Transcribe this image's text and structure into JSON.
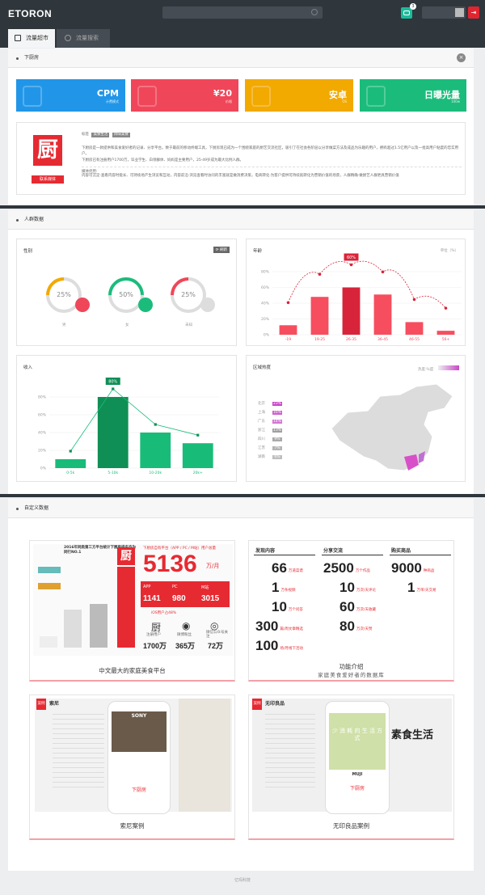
{
  "app": {
    "logo": "ETORON",
    "notif_count": "3",
    "logout_icon": "logout-icon"
  },
  "tabs": [
    {
      "label": "流量超市"
    },
    {
      "label": "流量搜索"
    }
  ],
  "media_panel": {
    "title": "下厨房",
    "kpis": [
      {
        "value": "CPM",
        "label": "计费模式",
        "color": "#2196e8"
      },
      {
        "value": "¥20",
        "label": "价格",
        "color": "#f0465a"
      },
      {
        "value": "安卓",
        "label": "OS",
        "color": "#f2a900"
      },
      {
        "value": "日曝光量",
        "label": "100w",
        "color": "#1bbc7b"
      }
    ],
    "logo_char": "厨",
    "contact_label": "联系媒体",
    "tags_label": "标签",
    "tags": [
      "美食生活",
      "风味美食"
    ],
    "desc": "下厨房是一款提供和美食爱好者的记录、分享平台。致于最前的移动终端工具，下厨房现已成为一个围绕家庭的厨艺交流社区，吸引了在社会各阶层以分享做菜方法及成品为乐趣的用户，拥有超过1.5亿用户以及一批高用户粘度的忠实用户。",
    "desc2": "下厨房已有注册用户1700万，毕业学生、白领群体、妈妈是主要用户，25-49岁成为最大比例人群。",
    "note_label": "媒体优势:",
    "note": "内容可沉淀·查看内容时能长、可持续地产生浏览和互动，内容前沿·浏览查看时访问的丰富就是做消费决策，电商转化·为客户提供可持续就转化为营销价值的场景，人群精确·做厨艺人群更具营销价值"
  },
  "audience": {
    "title": "人群数据",
    "gender": {
      "title": "性别",
      "btn": "刷新",
      "items": [
        {
          "value": "25%",
          "label": "男",
          "color": "#f2a900"
        },
        {
          "value": "50%",
          "label": "女",
          "color": "#1bbc7b"
        },
        {
          "value": "25%",
          "label": "未知",
          "color": "#f0465a"
        }
      ]
    },
    "age": {
      "title": "年龄",
      "unit": "单位（%）",
      "highlight": "60%"
    },
    "income": {
      "title": "收入",
      "highlight": "80%"
    },
    "region": {
      "title": "区域热度",
      "legend_label": "热度·%度",
      "items": [
        {
          "name": "北京",
          "value": "23%"
        },
        {
          "name": "上海",
          "value": "16%"
        },
        {
          "name": "广东",
          "value": "14%"
        },
        {
          "name": "浙江",
          "value": "13%"
        },
        {
          "name": "四川",
          "value": "9%"
        },
        {
          "name": "江苏",
          "value": "7%"
        },
        {
          "name": "湖南",
          "value": "6%"
        }
      ]
    }
  },
  "chart_data": [
    {
      "type": "bar",
      "title": "年龄",
      "categories": [
        "-19",
        "19-25",
        "26-35",
        "36-45",
        "46-55",
        "56+"
      ],
      "values": [
        12,
        48,
        60,
        51,
        16,
        5
      ],
      "ylim": [
        0,
        80
      ],
      "yticks": [
        "0%",
        "20%",
        "40%",
        "60%",
        "80%"
      ]
    },
    {
      "type": "bar",
      "title": "收入",
      "categories": [
        "0-5k",
        "5-10k",
        "10-20k",
        "20k+"
      ],
      "values": [
        10,
        80,
        40,
        28
      ],
      "ylim": [
        0,
        80
      ],
      "yticks": [
        "0%",
        "20%",
        "40%",
        "60%",
        "80%"
      ]
    }
  ],
  "custom": {
    "title": "自定义数据",
    "case1": {
      "caption": "中文最大的家庭美食平台",
      "big": "5136",
      "unit": "万/月",
      "header": "下厨房自有平台（APP / PC / M站）用户总量",
      "app": "APP",
      "pc": "PC",
      "m": "M站",
      "app_v": "1141",
      "pc_v": "980",
      "m_v": "3015",
      "ios": "iOS用户占",
      "ios_pct": "48%",
      "stat1": "1700万",
      "stat1_l": "注册用户",
      "stat2": "365万",
      "stat2_l": "微博粉丝",
      "stat3": "72万",
      "stat3_l": "微信公众号关注",
      "left_title": "2016年同类第三方平台统计下厨房排名均为同行NO.1"
    },
    "case2": {
      "caption": "功能介绍",
      "subtitle": "家庭美食爱好者的数据库",
      "col1": "发现内容",
      "col2": "分享交流",
      "col3": "购买商品",
      "rows": [
        [
          {
            "v": "66",
            "u": "万道菜谱"
          },
          {
            "v": "2500",
            "u": "万个作品"
          },
          {
            "v": "9000",
            "u": "种商品"
          }
        ],
        [
          {
            "v": "1",
            "u": "万条视频"
          },
          {
            "v": "10",
            "u": "万次/天评论"
          },
          {
            "v": "1",
            "u": "万单/天交易"
          }
        ],
        [
          {
            "v": "10",
            "u": "万个问答"
          },
          {
            "v": "60",
            "u": "万次/天收藏"
          },
          {
            "v": "",
            "u": ""
          }
        ],
        [
          {
            "v": "300",
            "u": "篇/周文章精选"
          },
          {
            "v": "80",
            "u": "万次/天赞"
          },
          {
            "v": "",
            "u": ""
          }
        ],
        [
          {
            "v": "100",
            "u": "场/月线下活动"
          },
          {
            "v": "",
            "u": ""
          },
          {
            "v": "",
            "u": ""
          }
        ]
      ]
    },
    "case3": {
      "caption": "索尼案例",
      "brand": "索尼",
      "tag": "案例",
      "brand_logo": "SONY",
      "app": "下厨房"
    },
    "case4": {
      "caption": "无印良品案例",
      "brand": "无印良品",
      "tag": "案例",
      "headline": "素食生活",
      "phone_text": "少 消 耗 的 生 活 方 式",
      "muji": "MUJI",
      "app": "下厨房"
    }
  },
  "footer": "亿玛科技"
}
